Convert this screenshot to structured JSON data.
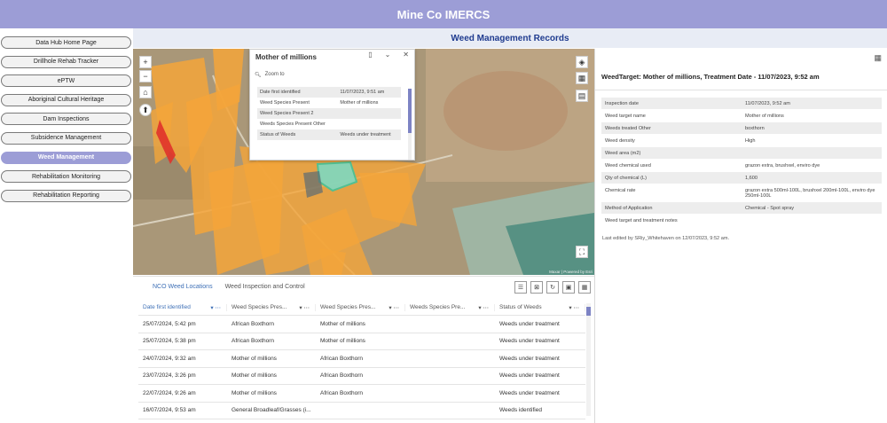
{
  "app": {
    "title": "Mine Co IMERCS"
  },
  "page": {
    "title": "Weed Management Records"
  },
  "sidebar": {
    "items": [
      {
        "label": "Data Hub Home Page",
        "active": false
      },
      {
        "label": "Drillhole Rehab Tracker",
        "active": false
      },
      {
        "label": "ePTW",
        "active": false
      },
      {
        "label": "Aboriginal Cultural Heritage",
        "active": false
      },
      {
        "label": "Dam Inspections",
        "active": false
      },
      {
        "label": "Subsidence Management",
        "active": false
      },
      {
        "label": "Weed Management",
        "active": true
      },
      {
        "label": "Rehabilitation Monitoring",
        "active": false
      },
      {
        "label": "Rehabilitation Reporting",
        "active": false
      }
    ]
  },
  "map": {
    "controls": {
      "zoom_in": "+",
      "zoom_out": "−"
    },
    "attribution": "Maxar | Powered by Esri",
    "popup": {
      "title": "Mother of millions",
      "zoom_to": "Zoom to",
      "rows": [
        {
          "label": "Date first identified",
          "value": "11/07/2023, 9:51 am"
        },
        {
          "label": "Weed Species Present",
          "value": "Mother of millions"
        },
        {
          "label": "Weed Species Present 2",
          "value": ""
        },
        {
          "label": "Weeds Species Present Other",
          "value": ""
        },
        {
          "label": "Status of Weeds",
          "value": "Weeds under treatment"
        }
      ]
    }
  },
  "table": {
    "tabs": [
      "NCO Weed Locations",
      "Weed Inspection and Control"
    ],
    "columns": [
      "Date first identified",
      "Weed Species Pres...",
      "Weed Species Pres...",
      "Weeds Species Pre...",
      "Status of Weeds"
    ],
    "rows": [
      [
        "25/07/2024, 5:42 pm",
        "African Boxthorn",
        "Mother of millions",
        "",
        "Weeds under treatment"
      ],
      [
        "25/07/2024, 5:38 pm",
        "African Boxthorn",
        "Mother of millions",
        "",
        "Weeds under treatment"
      ],
      [
        "24/07/2024, 9:32 am",
        "Mother of millions",
        "African Boxthorn",
        "",
        "Weeds under treatment"
      ],
      [
        "23/07/2024, 3:26 pm",
        "Mother of millions",
        "African Boxthorn",
        "",
        "Weeds under treatment"
      ],
      [
        "22/07/2024, 9:26 am",
        "Mother of millions",
        "African Boxthorn",
        "",
        "Weeds under treatment"
      ],
      [
        "16/07/2024, 9:53 am",
        "General Broadleaf/Grasses (i...",
        "",
        "",
        "Weeds identified"
      ]
    ]
  },
  "detail": {
    "title": "WeedTarget: Mother of millions, Treatment Date - 11/07/2023, 9:52 am",
    "rows": [
      {
        "label": "Inspection date",
        "value": "11/07/2023, 9:52 am"
      },
      {
        "label": "Weed target name",
        "value": "Mother of millions"
      },
      {
        "label": "Weeds treated Other",
        "value": "boxthorn"
      },
      {
        "label": "Weed density",
        "value": "High"
      },
      {
        "label": "Weed area (m2)",
        "value": ""
      },
      {
        "label": "Weed chemical used",
        "value": "grazon extra, brushxel, enviro dye"
      },
      {
        "label": "Qty of chemical (L)",
        "value": "1,600"
      },
      {
        "label": "Chemical rate",
        "value": "grazon extra 500ml-100L, brushxel 200ml-100L, enviro dye 250ml-100L"
      },
      {
        "label": "Method of Application",
        "value": "Chemical - Spot spray"
      },
      {
        "label": "Weed target and treatment notes",
        "value": ""
      }
    ],
    "footer": "Last edited by SRiy_Whitehaven on 12/07/2023, 9:52 am."
  }
}
